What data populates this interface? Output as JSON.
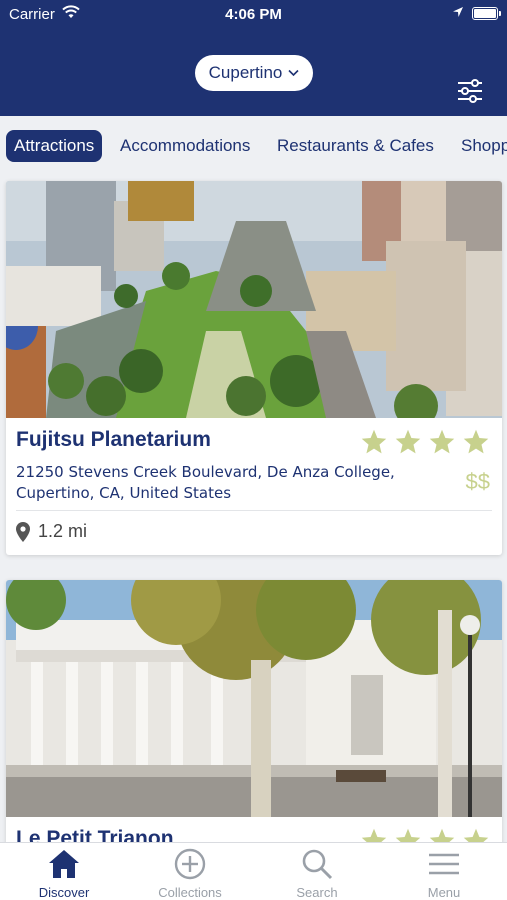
{
  "status_bar": {
    "carrier": "Carrier",
    "time": "4:06 PM"
  },
  "header": {
    "city": "Cupertino"
  },
  "tabs": [
    {
      "label": "Attractions",
      "active": true
    },
    {
      "label": "Accommodations",
      "active": false
    },
    {
      "label": "Restaurants & Cafes",
      "active": false
    },
    {
      "label": "Shopp",
      "active": false
    }
  ],
  "cards": [
    {
      "title": "Fujitsu Planetarium",
      "address": "21250 Stevens Creek Boulevard, De Anza College, Cupertino, CA, United States",
      "price": "$$",
      "distance": "1.2 mi",
      "rating": 4
    },
    {
      "title": "Le Petit Trianon",
      "rating": 4
    }
  ],
  "nav": [
    {
      "label": "Discover",
      "icon": "home-icon",
      "active": true
    },
    {
      "label": "Collections",
      "icon": "plus-circle-icon",
      "active": false
    },
    {
      "label": "Search",
      "icon": "search-icon",
      "active": false
    },
    {
      "label": "Menu",
      "icon": "menu-icon",
      "active": false
    }
  ],
  "colors": {
    "brand": "#1e3272",
    "star": "#c7d18d",
    "background": "#eef0f3"
  }
}
